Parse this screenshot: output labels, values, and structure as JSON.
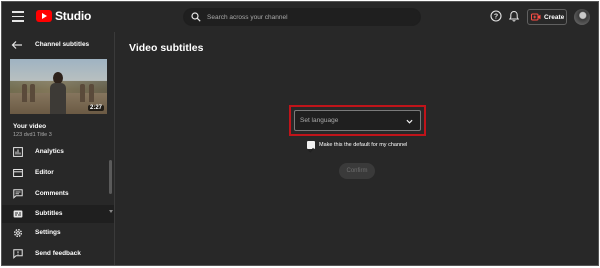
{
  "header": {
    "brand": "Studio",
    "search_placeholder": "Search across your channel",
    "create_label": "Create",
    "icons": [
      "menu-icon",
      "youtube-logo",
      "search-icon",
      "help-icon",
      "bell-icon",
      "video-plus-icon"
    ]
  },
  "sidebar": {
    "title": "Channel subtitles",
    "video": {
      "duration": "2:27",
      "heading": "Your video",
      "subtitle": "123 dvd1 Title 3"
    },
    "items": [
      {
        "label": "Analytics",
        "icon": "analytics-icon"
      },
      {
        "label": "Editor",
        "icon": "editor-icon"
      },
      {
        "label": "Comments",
        "icon": "comments-icon"
      },
      {
        "label": "Subtitles",
        "icon": "subtitles-icon",
        "active": true
      },
      {
        "label": "Settings",
        "icon": "settings-icon"
      },
      {
        "label": "Send feedback",
        "icon": "feedback-icon"
      }
    ]
  },
  "main": {
    "title": "Video subtitles",
    "language_select": {
      "value": "Set language"
    },
    "default_checkbox": {
      "label": "Make this the default for my channel",
      "checked": true
    },
    "confirm_label": "Confirm"
  },
  "colors": {
    "background": "#282828",
    "highlight": "#c0141a",
    "brand_red": "#ff0000"
  }
}
